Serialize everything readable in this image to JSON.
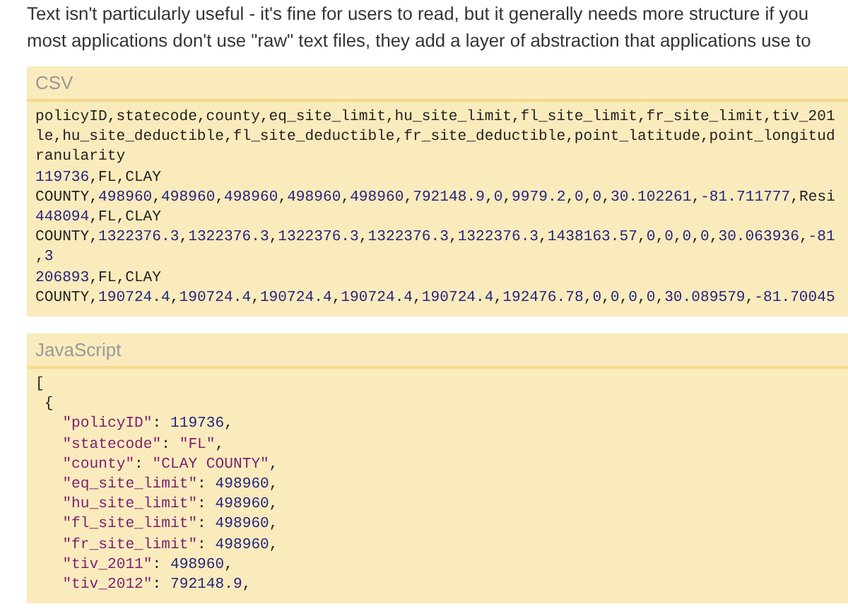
{
  "intro_lines": [
    "Text isn't particularly useful - it's fine for users to read, but it generally needs more structure if you",
    "most applications don't use \"raw\" text files, they add a layer of abstraction that applications use to"
  ],
  "code_blocks": [
    {
      "title": "CSV",
      "lines": [
        {
          "kind": "plain",
          "segments": [
            {
              "kind": "plain",
              "text": "policyID,statecode,county,eq_site_limit,hu_site_limit,fl_site_limit,fr_site_limit,tiv_201"
            }
          ]
        },
        {
          "kind": "plain",
          "segments": [
            {
              "kind": "plain",
              "text": "le,hu_site_deductible,fl_site_deductible,fr_site_deductible,point_latitude,point_longitud"
            }
          ]
        },
        {
          "kind": "plain",
          "segments": [
            {
              "kind": "plain",
              "text": "ranularity"
            }
          ]
        },
        {
          "kind": "plain",
          "segments": [
            {
              "kind": "number",
              "text": "119736"
            },
            {
              "kind": "plain",
              "text": ",FL,CLAY"
            }
          ]
        },
        {
          "kind": "plain",
          "segments": [
            {
              "kind": "plain",
              "text": "COUNTY,"
            },
            {
              "kind": "number",
              "text": "498960"
            },
            {
              "kind": "plain",
              "text": ","
            },
            {
              "kind": "number",
              "text": "498960"
            },
            {
              "kind": "plain",
              "text": ","
            },
            {
              "kind": "number",
              "text": "498960"
            },
            {
              "kind": "plain",
              "text": ","
            },
            {
              "kind": "number",
              "text": "498960"
            },
            {
              "kind": "plain",
              "text": ","
            },
            {
              "kind": "number",
              "text": "498960"
            },
            {
              "kind": "plain",
              "text": ","
            },
            {
              "kind": "number",
              "text": "792148.9"
            },
            {
              "kind": "plain",
              "text": ","
            },
            {
              "kind": "number",
              "text": "0"
            },
            {
              "kind": "plain",
              "text": ","
            },
            {
              "kind": "number",
              "text": "9979.2"
            },
            {
              "kind": "plain",
              "text": ","
            },
            {
              "kind": "number",
              "text": "0"
            },
            {
              "kind": "plain",
              "text": ","
            },
            {
              "kind": "number",
              "text": "0"
            },
            {
              "kind": "plain",
              "text": ","
            },
            {
              "kind": "number",
              "text": "30.102261"
            },
            {
              "kind": "plain",
              "text": ","
            },
            {
              "kind": "number",
              "text": "-81.711777"
            },
            {
              "kind": "plain",
              "text": ",Resi"
            }
          ]
        },
        {
          "kind": "plain",
          "segments": [
            {
              "kind": "number",
              "text": "448094"
            },
            {
              "kind": "plain",
              "text": ",FL,CLAY"
            }
          ]
        },
        {
          "kind": "plain",
          "segments": [
            {
              "kind": "plain",
              "text": "COUNTY,"
            },
            {
              "kind": "number",
              "text": "1322376.3"
            },
            {
              "kind": "plain",
              "text": ","
            },
            {
              "kind": "number",
              "text": "1322376.3"
            },
            {
              "kind": "plain",
              "text": ","
            },
            {
              "kind": "number",
              "text": "1322376.3"
            },
            {
              "kind": "plain",
              "text": ","
            },
            {
              "kind": "number",
              "text": "1322376.3"
            },
            {
              "kind": "plain",
              "text": ","
            },
            {
              "kind": "number",
              "text": "1322376.3"
            },
            {
              "kind": "plain",
              "text": ","
            },
            {
              "kind": "number",
              "text": "1438163.57"
            },
            {
              "kind": "plain",
              "text": ","
            },
            {
              "kind": "number",
              "text": "0"
            },
            {
              "kind": "plain",
              "text": ","
            },
            {
              "kind": "number",
              "text": "0"
            },
            {
              "kind": "plain",
              "text": ","
            },
            {
              "kind": "number",
              "text": "0"
            },
            {
              "kind": "plain",
              "text": ","
            },
            {
              "kind": "number",
              "text": "0"
            },
            {
              "kind": "plain",
              "text": ","
            },
            {
              "kind": "number",
              "text": "30.063936"
            },
            {
              "kind": "plain",
              "text": ","
            },
            {
              "kind": "number",
              "text": "-81"
            }
          ]
        },
        {
          "kind": "plain",
          "segments": [
            {
              "kind": "plain",
              "text": ","
            },
            {
              "kind": "number",
              "text": "3"
            }
          ]
        },
        {
          "kind": "plain",
          "segments": [
            {
              "kind": "number",
              "text": "206893"
            },
            {
              "kind": "plain",
              "text": ",FL,CLAY"
            }
          ]
        },
        {
          "kind": "plain",
          "segments": [
            {
              "kind": "plain",
              "text": "COUNTY,"
            },
            {
              "kind": "number",
              "text": "190724.4"
            },
            {
              "kind": "plain",
              "text": ","
            },
            {
              "kind": "number",
              "text": "190724.4"
            },
            {
              "kind": "plain",
              "text": ","
            },
            {
              "kind": "number",
              "text": "190724.4"
            },
            {
              "kind": "plain",
              "text": ","
            },
            {
              "kind": "number",
              "text": "190724.4"
            },
            {
              "kind": "plain",
              "text": ","
            },
            {
              "kind": "number",
              "text": "190724.4"
            },
            {
              "kind": "plain",
              "text": ","
            },
            {
              "kind": "number",
              "text": "192476.78"
            },
            {
              "kind": "plain",
              "text": ","
            },
            {
              "kind": "number",
              "text": "0"
            },
            {
              "kind": "plain",
              "text": ","
            },
            {
              "kind": "number",
              "text": "0"
            },
            {
              "kind": "plain",
              "text": ","
            },
            {
              "kind": "number",
              "text": "0"
            },
            {
              "kind": "plain",
              "text": ","
            },
            {
              "kind": "number",
              "text": "0"
            },
            {
              "kind": "plain",
              "text": ","
            },
            {
              "kind": "number",
              "text": "30.089579"
            },
            {
              "kind": "plain",
              "text": ","
            },
            {
              "kind": "number",
              "text": "-81.70045"
            }
          ]
        }
      ]
    },
    {
      "title": "JavaScript",
      "lines": [
        {
          "kind": "plain",
          "segments": [
            {
              "kind": "plain",
              "text": "["
            }
          ]
        },
        {
          "kind": "object",
          "segments": [
            {
              "kind": "plain",
              "text": "{"
            }
          ]
        },
        {
          "kind": "member",
          "segments": [
            {
              "kind": "string",
              "text": "\"policyID\""
            },
            {
              "kind": "plain",
              "text": ": "
            },
            {
              "kind": "number",
              "text": "119736"
            },
            {
              "kind": "plain",
              "text": ","
            }
          ]
        },
        {
          "kind": "member",
          "segments": [
            {
              "kind": "string",
              "text": "\"statecode\""
            },
            {
              "kind": "plain",
              "text": ": "
            },
            {
              "kind": "string",
              "text": "\"FL\""
            },
            {
              "kind": "plain",
              "text": ","
            }
          ]
        },
        {
          "kind": "member",
          "segments": [
            {
              "kind": "string",
              "text": "\"county\""
            },
            {
              "kind": "plain",
              "text": ": "
            },
            {
              "kind": "string",
              "text": "\"CLAY COUNTY\""
            },
            {
              "kind": "plain",
              "text": ","
            }
          ]
        },
        {
          "kind": "member",
          "segments": [
            {
              "kind": "string",
              "text": "\"eq_site_limit\""
            },
            {
              "kind": "plain",
              "text": ": "
            },
            {
              "kind": "number",
              "text": "498960"
            },
            {
              "kind": "plain",
              "text": ","
            }
          ]
        },
        {
          "kind": "member",
          "segments": [
            {
              "kind": "string",
              "text": "\"hu_site_limit\""
            },
            {
              "kind": "plain",
              "text": ": "
            },
            {
              "kind": "number",
              "text": "498960"
            },
            {
              "kind": "plain",
              "text": ","
            }
          ]
        },
        {
          "kind": "member",
          "segments": [
            {
              "kind": "string",
              "text": "\"fl_site_limit\""
            },
            {
              "kind": "plain",
              "text": ": "
            },
            {
              "kind": "number",
              "text": "498960"
            },
            {
              "kind": "plain",
              "text": ","
            }
          ]
        },
        {
          "kind": "member",
          "segments": [
            {
              "kind": "string",
              "text": "\"fr_site_limit\""
            },
            {
              "kind": "plain",
              "text": ": "
            },
            {
              "kind": "number",
              "text": "498960"
            },
            {
              "kind": "plain",
              "text": ","
            }
          ]
        },
        {
          "kind": "member",
          "segments": [
            {
              "kind": "string",
              "text": "\"tiv_2011\""
            },
            {
              "kind": "plain",
              "text": ": "
            },
            {
              "kind": "number",
              "text": "498960"
            },
            {
              "kind": "plain",
              "text": ","
            }
          ]
        },
        {
          "kind": "member",
          "segments": [
            {
              "kind": "string",
              "text": "\"tiv_2012\""
            },
            {
              "kind": "plain",
              "text": ": "
            },
            {
              "kind": "number",
              "text": "792148.9"
            },
            {
              "kind": "plain",
              "text": ","
            }
          ]
        }
      ]
    }
  ]
}
